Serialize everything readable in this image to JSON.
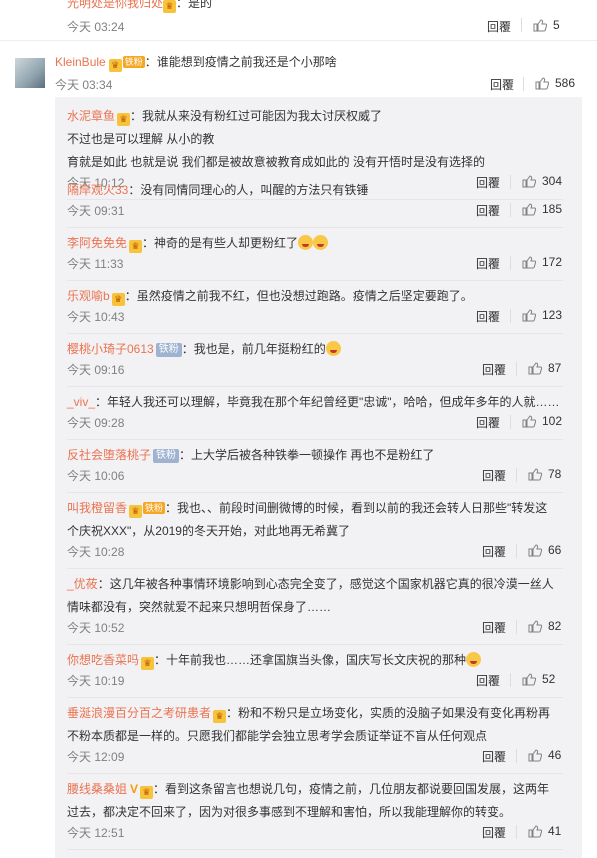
{
  "prev_comment": {
    "user": "光明处是你我归处",
    "text": "：是的",
    "time": "今天 03:24",
    "reply": "回覆",
    "likes": "5"
  },
  "main_comment": {
    "user": "KleinBule",
    "badge": "铁粉",
    "text": "：谁能想到疫情之前我还是个小那啥",
    "time": "今天 03:34",
    "reply": "回覆",
    "likes": "586"
  },
  "replies": [
    {
      "user": "水泥章鱼",
      "lines": [
        "：我就从来没有粉红过可能因为我太讨厌权威了",
        "不过也是可以理解 从小的教",
        "育就是如此 也就是说 我们都是被故意被教育成如此的 没有开悟时是没有选择的"
      ],
      "time": "今天 10:12",
      "reply": "回覆",
      "likes": "304"
    },
    {
      "user": "隔岸观火33",
      "lines": [
        "：没有同情同理心的人，叫醒的方法只有铁锤"
      ],
      "time": "今天 09:31",
      "reply": "回覆",
      "likes": "185"
    },
    {
      "user": "李阿免免免",
      "lines": [
        "：神奇的是有些人却更粉红了"
      ],
      "time": "今天 11:33",
      "reply": "回覆",
      "likes": "172"
    },
    {
      "user": "乐观喻b",
      "lines": [
        "：虽然疫情之前我不红，但也没想过跑路。疫情之后坚定要跑了。"
      ],
      "time": "今天 10:43",
      "reply": "回覆",
      "likes": "123"
    },
    {
      "user": "樱桃小琦子0613",
      "fan": "铁粉",
      "lines": [
        "：我也是，前几年挺粉红的"
      ],
      "time": "今天 09:16",
      "reply": "回覆",
      "likes": "87"
    },
    {
      "user": "_viv_",
      "lines": [
        "：年轻人我还可以理解，毕竟我在那个年纪曾经更\"忠诚\"，哈哈，但成年多年的人就……"
      ],
      "time": "今天 09:28",
      "reply": "回覆",
      "likes": "102"
    },
    {
      "user": "反社会堕落桃子",
      "fan": "铁粉",
      "lines": [
        "：上大学后被各种铁拳一顿操作 再也不是粉红了"
      ],
      "time": "今天 10:06",
      "reply": "回覆",
      "likes": "78"
    },
    {
      "user": "叫我橙留香",
      "badge": "铁粉",
      "lines": [
        "：我也、、前段时间删微博的时候，看到以前的我还会转人日那些\"转发这",
        "个庆祝XXX\"，从2019的冬天开始，对此地再无希冀了"
      ],
      "time": "今天 10:28",
      "reply": "回覆",
      "likes": "66"
    },
    {
      "user": "_优莜",
      "lines": [
        "：这几年被各种事情环境影响到心态完全变了，感觉这个国家机器它真的很冷漠一丝人",
        "情味都没有，突然就爱不起来只想明哲保身了……"
      ],
      "time": "今天 10:52",
      "reply": "回覆",
      "likes": "82"
    },
    {
      "user": "你想吃香菜吗",
      "lines": [
        "：十年前我也……还拿国旗当头像，国庆写长文庆祝的那种"
      ],
      "time": "今天 10:19",
      "reply": "回覆",
      "likes": "52"
    },
    {
      "user": "垂涎浪漫百分百之考研患者",
      "lines": [
        "：粉和不粉只是立场变化，实质的没脑子如果没有变化再粉再",
        "不粉本质都是一样的。只愿我们都能学会独立思考学会质证举证不盲从任何观点"
      ],
      "time": "今天 12:09",
      "reply": "回覆",
      "likes": "46"
    },
    {
      "user": "腰线桑桑姐",
      "lines": [
        "：看到这条留言也想说几句，疫情之前，几位朋友都说要回国发展，这两年",
        "过去，都决定不回来了，因为对很多事感到不理解和害怕，所以我能理解你的转变。"
      ],
      "time": "今天 12:51",
      "reply": "回覆",
      "likes": "41"
    }
  ],
  "colors": {
    "username": "#eb7350",
    "time": "#808080",
    "panel": "#f2f2f5"
  }
}
